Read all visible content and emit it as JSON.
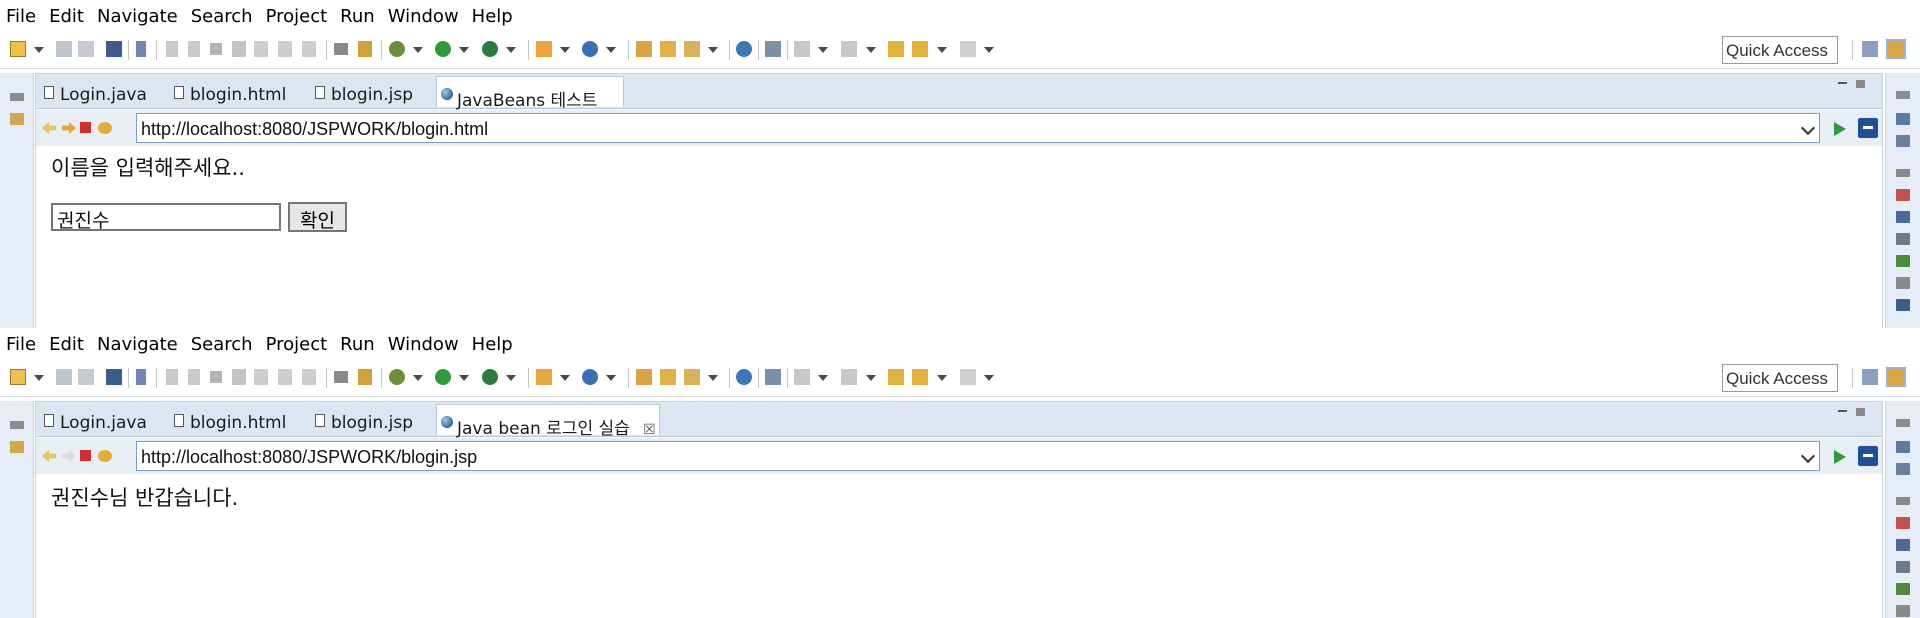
{
  "windows": [
    {
      "menu": [
        "File",
        "Edit",
        "Navigate",
        "Search",
        "Project",
        "Run",
        "Window",
        "Help"
      ],
      "quick_access": "Quick Access",
      "tabs": [
        {
          "label": "Login.java",
          "active": false
        },
        {
          "label": "blogin.html",
          "active": false
        },
        {
          "label": "blogin.jsp",
          "active": false
        },
        {
          "label": "JavaBeans 테스트",
          "active": true,
          "closable": true
        }
      ],
      "url": "http://localhost:8080/JSPWORK/blogin.html",
      "prompt": "이름을 입력해주세요..",
      "name_value": "권진수",
      "confirm_label": "확인"
    },
    {
      "menu": [
        "File",
        "Edit",
        "Navigate",
        "Search",
        "Project",
        "Run",
        "Window",
        "Help"
      ],
      "quick_access": "Quick Access",
      "tabs": [
        {
          "label": "Login.java",
          "active": false
        },
        {
          "label": "blogin.html",
          "active": false
        },
        {
          "label": "blogin.jsp",
          "active": false
        },
        {
          "label": "Java bean 로그인 실습",
          "active": true,
          "closable": true
        }
      ],
      "url": "http://localhost:8080/JSPWORK/blogin.jsp",
      "welcome": "권진수님 반갑습니다."
    }
  ],
  "close_glyph": "☒",
  "colors": {
    "accent": "#1f4f9a",
    "go": "#2e9b3a",
    "tab_bar": "#dce6f3",
    "side_strip": "#e6ecf5"
  }
}
